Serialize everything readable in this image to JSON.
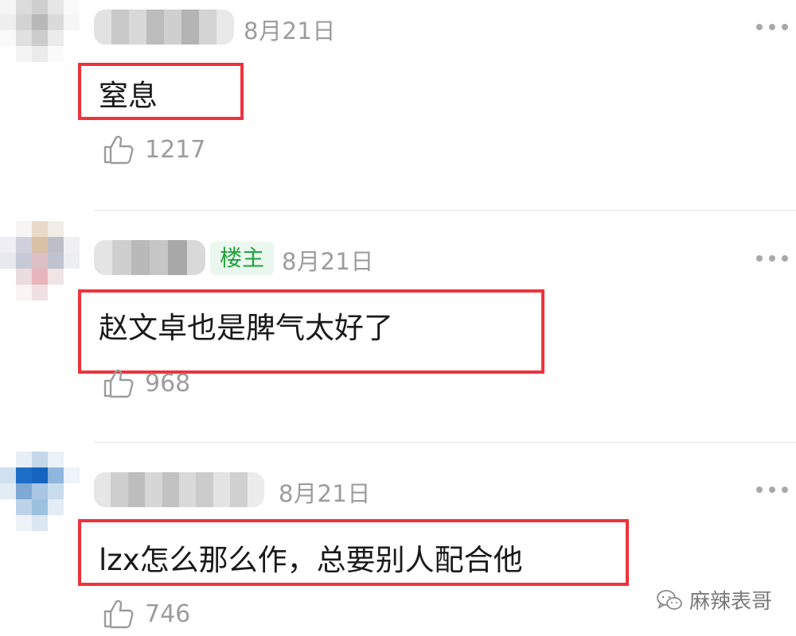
{
  "comments": [
    {
      "date": "8月21日",
      "text": "窒息",
      "likes": "1217",
      "is_host": false,
      "host_badge": ""
    },
    {
      "date": "8月21日",
      "text": "赵文卓也是脾气太好了",
      "likes": "968",
      "is_host": true,
      "host_badge": "楼主"
    },
    {
      "date": "8月21日",
      "text": "lzx怎么那么作，总要别人配合他",
      "likes": "746",
      "is_host": false,
      "host_badge": ""
    }
  ],
  "watermark": {
    "text": "麻辣表哥"
  },
  "colors": {
    "highlight_box": "#f0323c",
    "host_badge_bg": "#eaf7ee",
    "host_badge_text": "#22a33d",
    "muted_text": "#9c9c9c"
  },
  "icons": {
    "like": "thumbs-up-icon",
    "more": "more-dots-icon",
    "watermark": "wechat-icon"
  }
}
